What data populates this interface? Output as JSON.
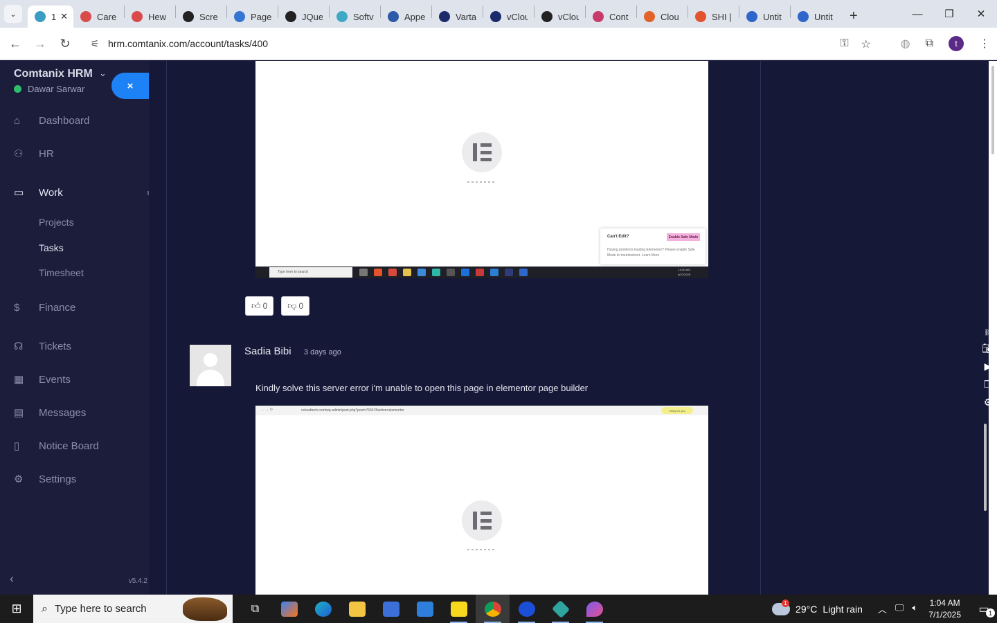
{
  "browser": {
    "tabs": [
      {
        "title": "1",
        "color": "#3b9cc4",
        "active": true
      },
      {
        "title": "Care",
        "color": "#d94b4b"
      },
      {
        "title": "Hew",
        "color": "#d94b4b"
      },
      {
        "title": "Scre",
        "color": "#222222"
      },
      {
        "title": "Page",
        "color": "#3576d3"
      },
      {
        "title": "JQue",
        "color": "#222222"
      },
      {
        "title": "Softv",
        "color": "#3fa9c5"
      },
      {
        "title": "Appe",
        "color": "#2d5aa8"
      },
      {
        "title": "Varta",
        "color": "#1b2a6b"
      },
      {
        "title": "vClou",
        "color": "#1b2a6b"
      },
      {
        "title": "vClou",
        "color": "#222222"
      },
      {
        "title": "Cont",
        "color": "#c73a6a"
      },
      {
        "title": "Clou",
        "color": "#e2622a"
      },
      {
        "title": "SHI |",
        "color": "#e2532e"
      },
      {
        "title": "Untit",
        "color": "#2f66c9"
      },
      {
        "title": "Untit",
        "color": "#2f66c9"
      }
    ],
    "url": "hrm.comtanix.com/account/tasks/400",
    "profile_initial": "t"
  },
  "sidebar": {
    "brand": "Comtanix HRM",
    "user": "Dawar Sarwar",
    "collapse_label": "×",
    "menu": [
      {
        "label": "Dashboard",
        "icon": "⌂"
      },
      {
        "label": "HR",
        "icon": "⚇"
      },
      {
        "label": "Work",
        "icon": "▭"
      },
      {
        "label": "Finance",
        "icon": "$"
      },
      {
        "label": "Tickets",
        "icon": "☊"
      },
      {
        "label": "Events",
        "icon": "▦"
      },
      {
        "label": "Messages",
        "icon": "▤"
      },
      {
        "label": "Notice Board",
        "icon": "▯"
      },
      {
        "label": "Settings",
        "icon": "⚙"
      }
    ],
    "work_sub": [
      "Projects",
      "Tasks",
      "Timesheet"
    ],
    "version": "v5.4.2"
  },
  "content": {
    "screenshot1": {
      "safe_mode_title": "Can't Edit?",
      "safe_mode_button": "Enable Safe Mode",
      "safe_mode_text": "Having problems loading Elementor? Please enable Safe Mode to troubleshoot. Learn More",
      "taskbar_search": "Type here to search",
      "clock": "10:00 AM\n6/27/2025"
    },
    "votes": {
      "likes": "0",
      "dislikes": "0"
    },
    "comment": {
      "author": "Sadia Bibi",
      "time": "3 days ago",
      "text": "Kindly solve this server error i'm unable to open this page in elementor page builder"
    },
    "screenshot2": {
      "url": "vcloudtech.com/wp-admin/post.php?post=765478action=elementor",
      "verify": "Verify it's you"
    }
  },
  "taskbar": {
    "search_placeholder": "Type here to search",
    "weather_temp": "29°C",
    "weather_desc": "Light rain",
    "weather_badge": "1",
    "time": "1:04 AM",
    "date": "7/1/2025",
    "notifications": "1"
  }
}
